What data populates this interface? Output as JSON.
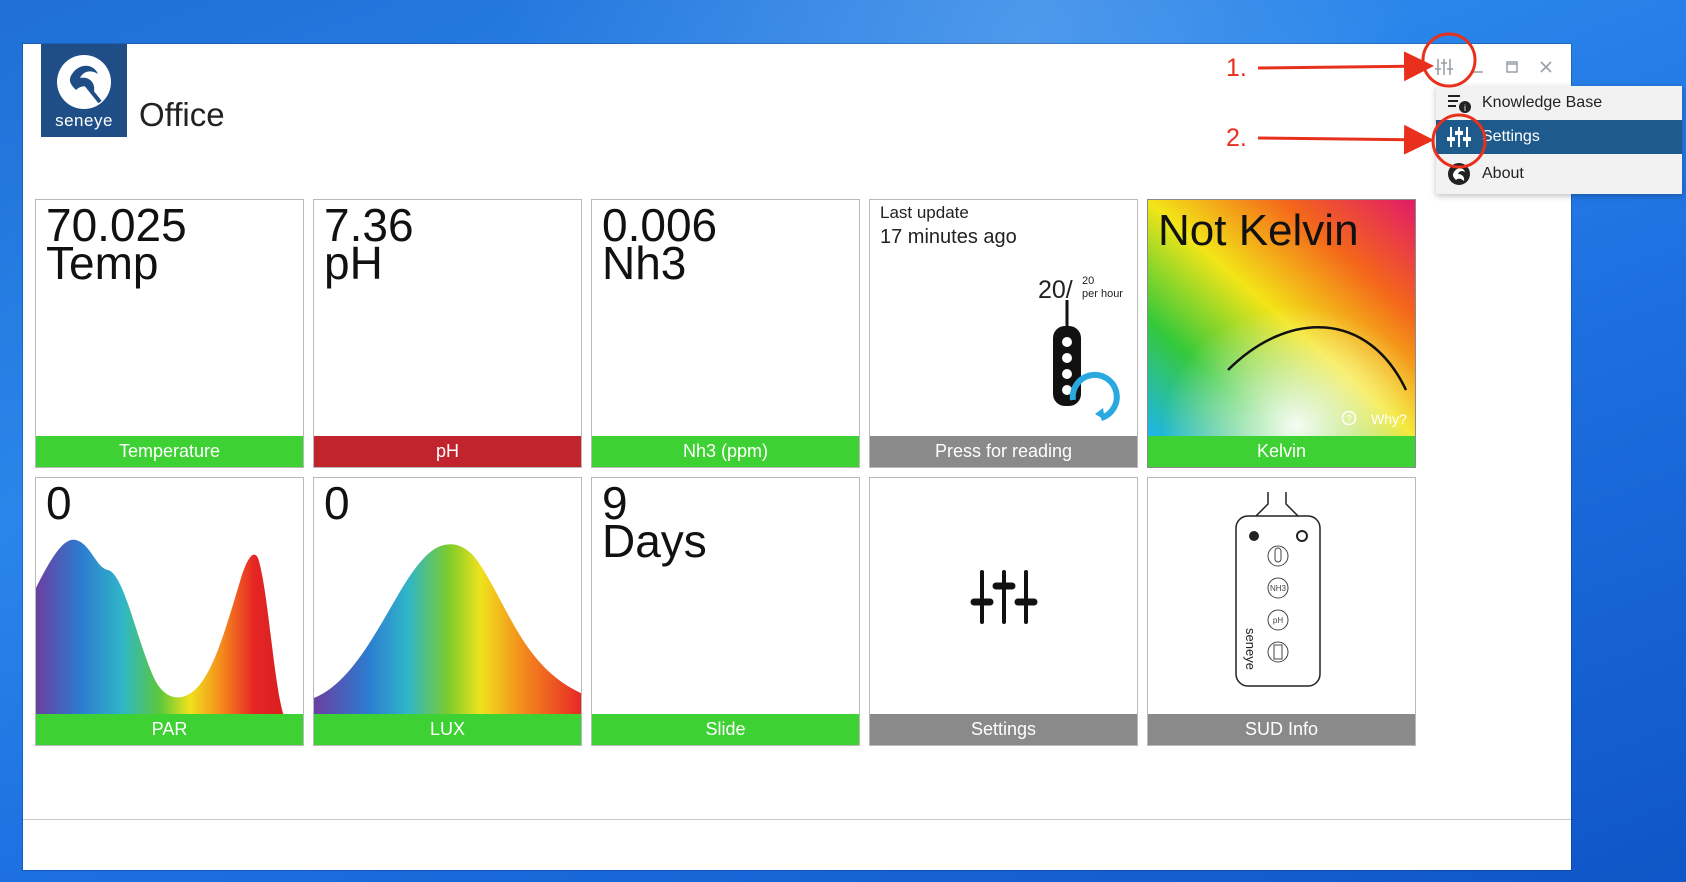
{
  "app": {
    "logo_text": "seneye",
    "title": "Office"
  },
  "menu": {
    "items": [
      {
        "label": "Knowledge Base",
        "icon": "knowledge-base-icon"
      },
      {
        "label": "Settings",
        "icon": "sliders-icon",
        "selected": true
      },
      {
        "label": "About",
        "icon": "seneye-logo-icon"
      }
    ]
  },
  "annotations": {
    "step1": "1.",
    "step2": "2.",
    "color": "#e8301c"
  },
  "tiles": [
    {
      "value": "70.025",
      "label": "Temp",
      "footer": "Temperature",
      "footer_color": "#3ed133"
    },
    {
      "value": "7.36",
      "label": "pH",
      "footer": "pH",
      "footer_color": "#c2242e"
    },
    {
      "value": "0.006",
      "label": "Nh3",
      "footer": "Nh3 (ppm)",
      "footer_color": "#3ed133"
    },
    {
      "caption": "Last update",
      "update_text": "17 minutes ago",
      "readings": "20/",
      "readings_limit": "20",
      "readings_unit": "per hour",
      "footer": "Press for reading",
      "footer_color": "#8a8a8a"
    },
    {
      "value": "Not Kelvin",
      "help": "Why?",
      "footer": "Kelvin",
      "footer_color": "#3ed133"
    },
    {
      "value": "0",
      "footer": "PAR",
      "footer_color": "#3ed133"
    },
    {
      "value": "0",
      "footer": "LUX",
      "footer_color": "#3ed133"
    },
    {
      "value": "9",
      "label": "Days",
      "footer": "Slide",
      "footer_color": "#3ed133"
    },
    {
      "footer": "Settings",
      "footer_color": "#8a8a8a",
      "icon": "sliders-icon"
    },
    {
      "footer": "SUD Info",
      "footer_color": "#8a8a8a",
      "icon": "device-icon",
      "device_text": "seneye",
      "sensor_labels": [
        "NH3",
        "pH"
      ]
    }
  ]
}
